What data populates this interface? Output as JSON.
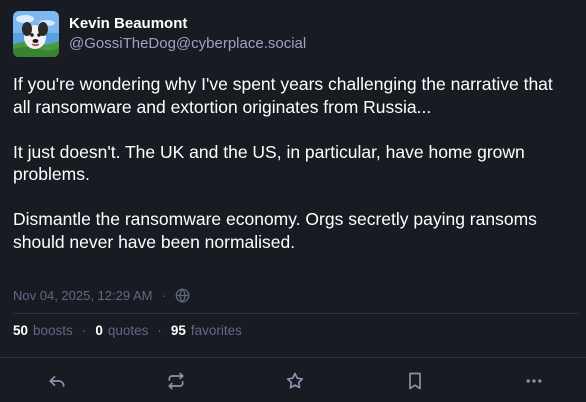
{
  "author": {
    "display_name": "Kevin Beaumont",
    "handle": "@GossiTheDog@cyberplace.social",
    "avatar_icon": "dog-avatar-icon"
  },
  "content": {
    "paragraphs": [
      "If you're wondering why I've spent years challenging the narrative that all ransomware and extortion originates from Russia...",
      "It just doesn't.  The UK and the US, in particular, have home grown problems.",
      "Dismantle the ransomware economy.  Orgs secretly paying ransoms should never have been normalised."
    ]
  },
  "meta": {
    "timestamp": "Nov 04, 2025, 12:29 AM",
    "separator": "·",
    "visibility_icon": "globe-icon"
  },
  "stats": {
    "boosts_count": "50",
    "boosts_label": "boosts",
    "quotes_count": "0",
    "quotes_label": "quotes",
    "favorites_count": "95",
    "favorites_label": "favorites",
    "separator": "·"
  },
  "actions": [
    {
      "name": "reply",
      "icon": "reply-icon"
    },
    {
      "name": "boost",
      "icon": "boost-icon"
    },
    {
      "name": "favorite",
      "icon": "star-icon"
    },
    {
      "name": "bookmark",
      "icon": "bookmark-icon"
    },
    {
      "name": "more",
      "icon": "more-icon"
    }
  ],
  "colors": {
    "background": "#191b22",
    "text": "#ffffff",
    "muted": "#606984",
    "handle": "#9ba3c2",
    "divider": "#2e3140"
  }
}
